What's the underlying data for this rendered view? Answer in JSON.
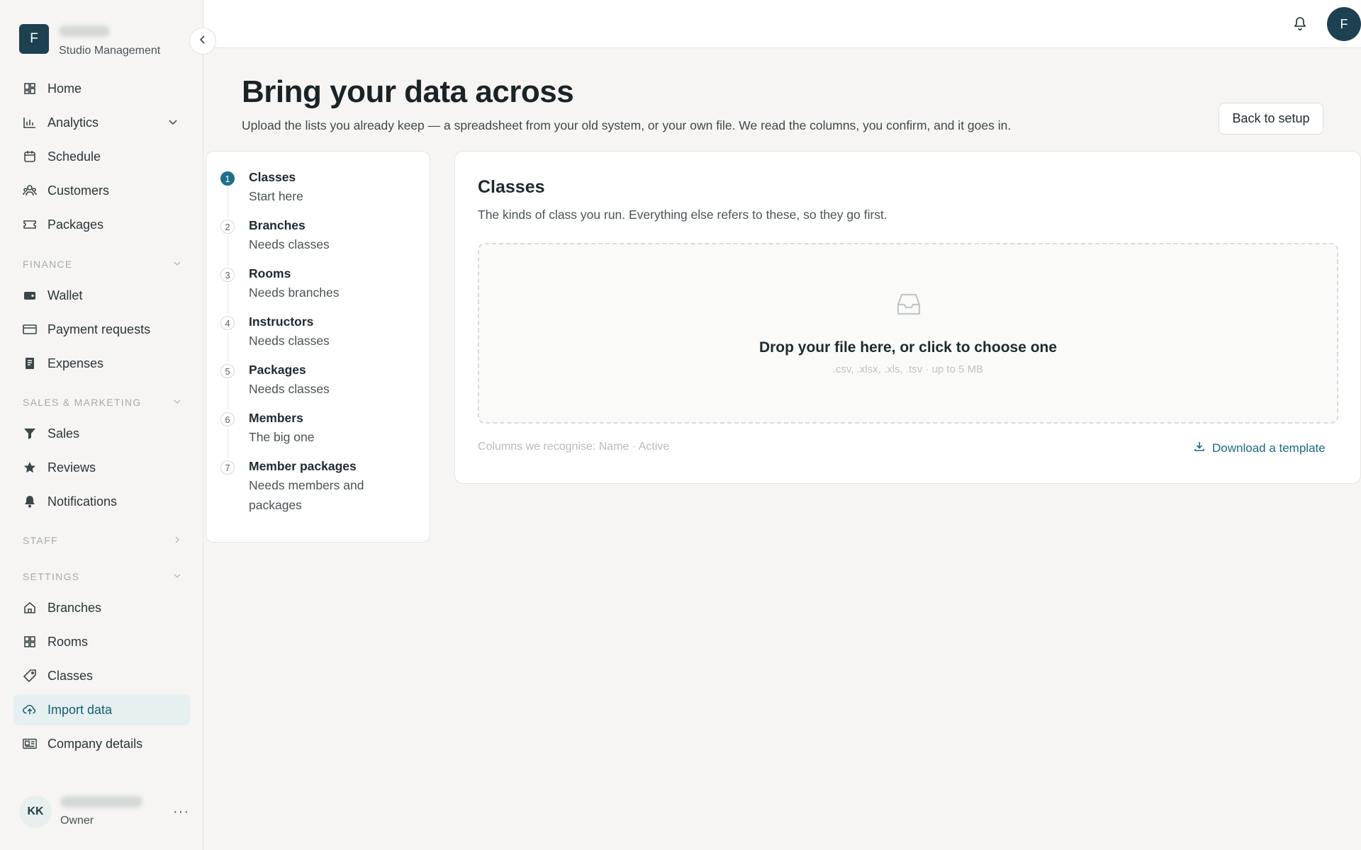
{
  "brand": {
    "initial": "F",
    "subtitle": "Studio Management"
  },
  "nav_main": [
    {
      "label": "Home",
      "icon": "grid-icon"
    },
    {
      "label": "Analytics",
      "icon": "bar-chart-icon"
    },
    {
      "label": "Schedule",
      "icon": "calendar-icon"
    },
    {
      "label": "Customers",
      "icon": "users-icon"
    },
    {
      "label": "Packages",
      "icon": "ticket-icon"
    }
  ],
  "sections": {
    "finance": "FINANCE",
    "sales": "SALES & MARKETING",
    "staff": "STAFF",
    "settings": "SETTINGS"
  },
  "nav_finance": [
    {
      "label": "Wallet",
      "icon": "wallet-icon"
    },
    {
      "label": "Payment requests",
      "icon": "credit-card-icon"
    },
    {
      "label": "Expenses",
      "icon": "receipt-icon"
    }
  ],
  "nav_sales": [
    {
      "label": "Sales",
      "icon": "filter-icon"
    },
    {
      "label": "Reviews",
      "icon": "star-icon"
    },
    {
      "label": "Notifications",
      "icon": "bell-icon"
    }
  ],
  "nav_settings": [
    {
      "label": "Branches",
      "icon": "home-icon"
    },
    {
      "label": "Rooms",
      "icon": "grid-icon"
    },
    {
      "label": "Classes",
      "icon": "tag-icon"
    },
    {
      "label": "Import data",
      "icon": "cloud-upload-icon"
    },
    {
      "label": "Company details",
      "icon": "id-card-icon"
    }
  ],
  "user": {
    "initials": "KK",
    "role": "Owner",
    "more": "···"
  },
  "topbar": {
    "avatar_initial": "F"
  },
  "header": {
    "title": "Bring your data across",
    "subtitle": "Upload the lists you already keep — a spreadsheet from your old system, or your own file. We read the columns, you confirm, and it goes in.",
    "back_button": "Back to setup"
  },
  "steps": [
    {
      "num": "1",
      "title": "Classes",
      "sub": "Start here",
      "current": true
    },
    {
      "num": "2",
      "title": "Branches",
      "sub": "Needs classes"
    },
    {
      "num": "3",
      "title": "Rooms",
      "sub": "Needs branches"
    },
    {
      "num": "4",
      "title": "Instructors",
      "sub": "Needs classes"
    },
    {
      "num": "5",
      "title": "Packages",
      "sub": "Needs classes"
    },
    {
      "num": "6",
      "title": "Members",
      "sub": "The big one"
    },
    {
      "num": "7",
      "title": "Member packages",
      "sub": "Needs members and packages"
    }
  ],
  "card": {
    "title": "Classes",
    "subtitle": "The kinds of class you run. Everything else refers to these, so they go first.",
    "drop_title": "Drop your file here, or click to choose one",
    "drop_hint": ".csv, .xlsx, .xls, .tsv · up to 5 MB",
    "columns": "Columns we recognise: Name · Active",
    "download": "Download a template"
  },
  "colors": {
    "accent": "#1a6a82",
    "brand": "#1d4150",
    "active_bg": "#e6f0f1"
  }
}
